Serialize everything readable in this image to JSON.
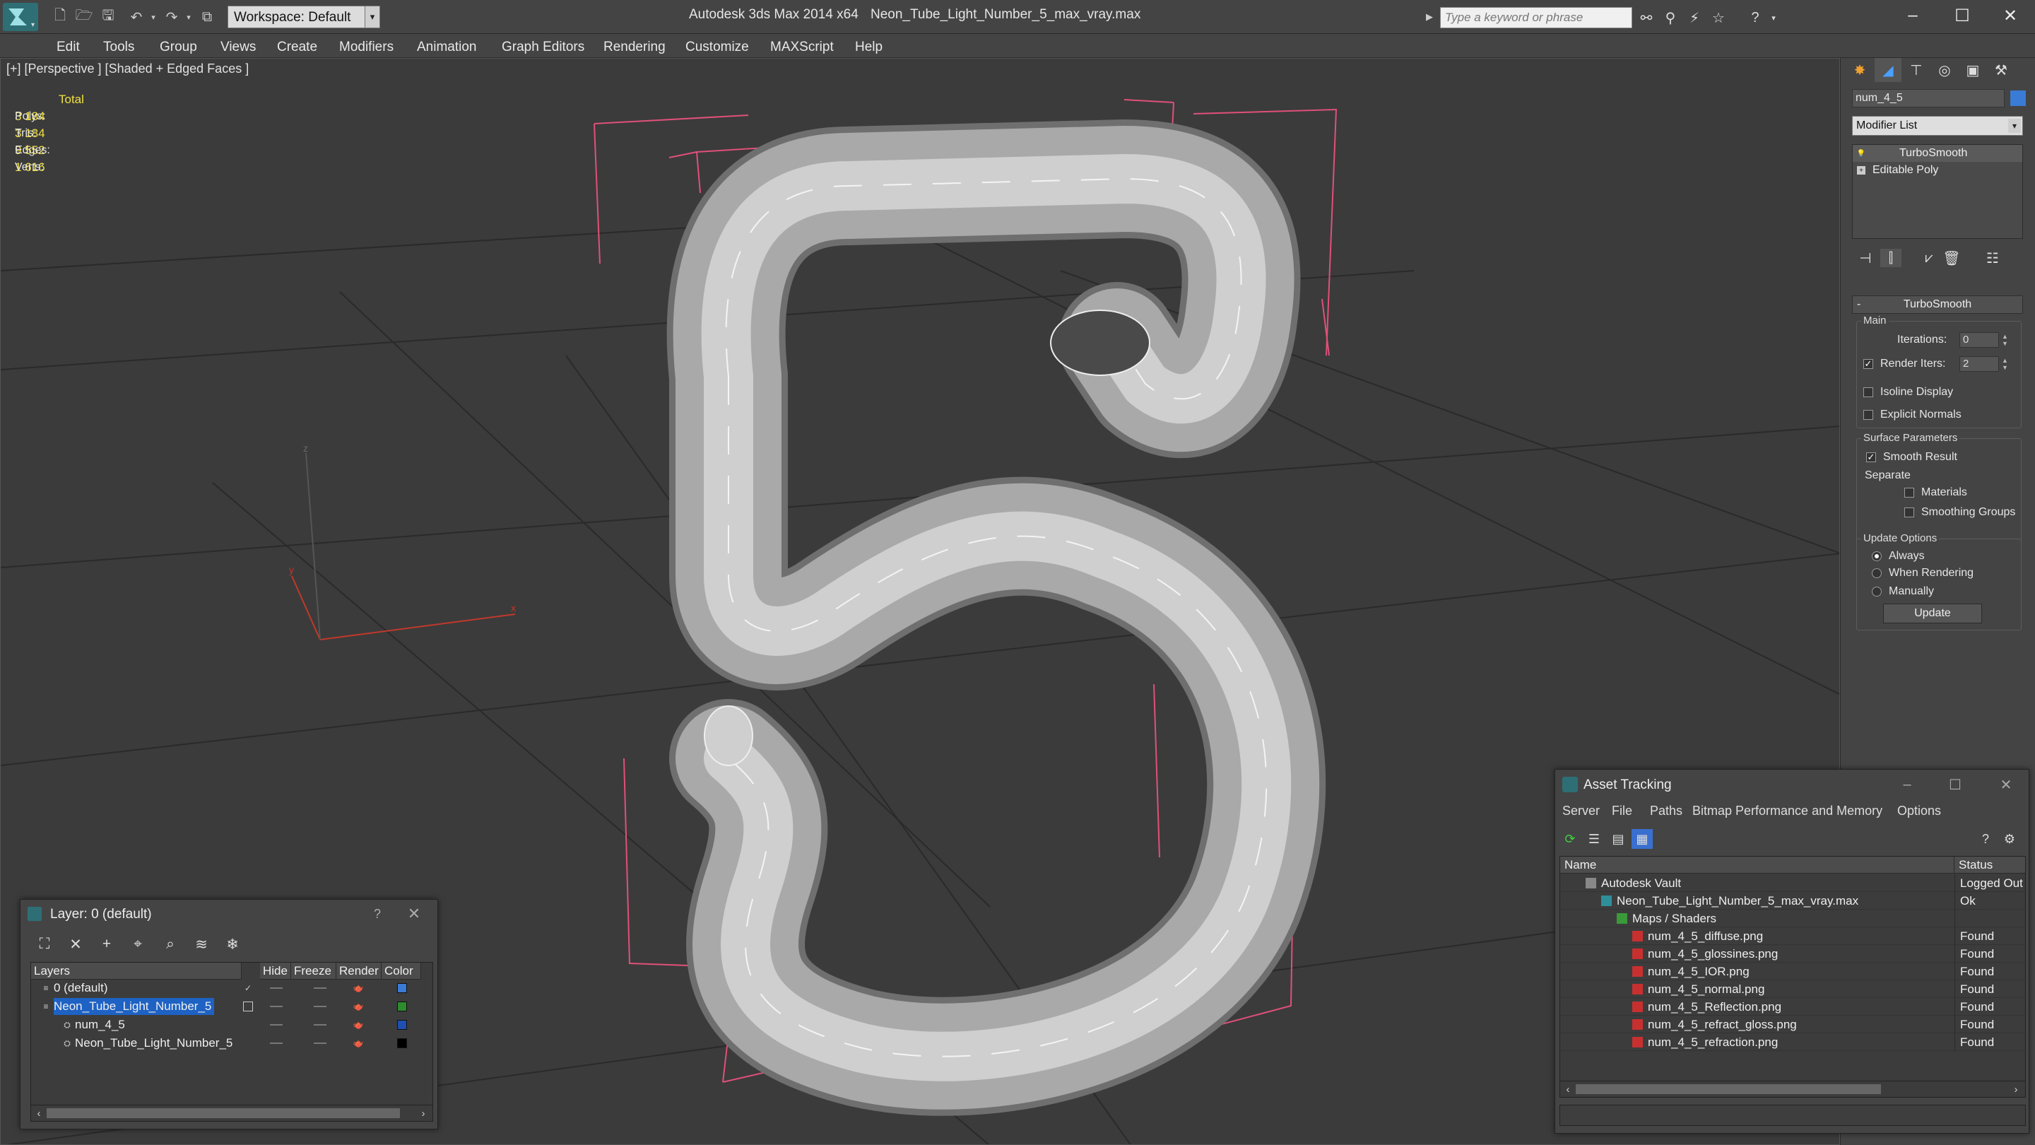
{
  "titlebar": {
    "workspace": "Workspace: Default",
    "app_title": "Autodesk 3ds Max  2014 x64",
    "file_title": "Neon_Tube_Light_Number_5_max_vray.max",
    "search_placeholder": "Type a keyword or phrase",
    "icons": [
      "new-icon",
      "open-icon",
      "save-icon",
      "undo-icon",
      "redo-icon",
      "hold-icon"
    ]
  },
  "menubar": [
    "Edit",
    "Tools",
    "Group",
    "Views",
    "Create",
    "Modifiers",
    "Animation",
    "Graph Editors",
    "Rendering",
    "Customize",
    "MAXScript",
    "Help"
  ],
  "viewport": {
    "label": "[+] [Perspective ] [Shaded + Edged Faces ]",
    "stats": {
      "header": "Total",
      "rows": [
        {
          "label": "Polys:",
          "value": "3 184"
        },
        {
          "label": "Tris:",
          "value": "3 184"
        },
        {
          "label": "Edges:",
          "value": "9 552"
        },
        {
          "label": "Verts:",
          "value": "1 616"
        }
      ]
    },
    "axis_labels": {
      "x": "x",
      "y": "y",
      "z": "z"
    }
  },
  "command_panel": {
    "object_name": "num_4_5",
    "object_color": "#3a7bd5",
    "modifier_list": "Modifier List",
    "stack": [
      {
        "label": "TurboSmooth",
        "selected": true
      },
      {
        "label": "Editable Poly",
        "selected": false
      }
    ],
    "rollout": {
      "title": "TurboSmooth",
      "collapse": "-",
      "main_group": "Main",
      "iterations_label": "Iterations:",
      "iterations_value": "0",
      "render_iters_label": "Render Iters:",
      "render_iters_value": "2",
      "render_iters_checked": true,
      "isoline": "Isoline Display",
      "explicit_normals": "Explicit Normals",
      "surface_group": "Surface Parameters",
      "smooth_result": "Smooth Result",
      "separate": "Separate",
      "materials": "Materials",
      "smoothing_groups": "Smoothing Groups",
      "update_group": "Update Options",
      "always": "Always",
      "when_rendering": "When Rendering",
      "manually": "Manually",
      "update_button": "Update"
    }
  },
  "asset_tracking": {
    "title": "Asset Tracking",
    "menus": [
      "Server",
      "File",
      "Paths",
      "Bitmap Performance and Memory",
      "Options"
    ],
    "columns": {
      "name": "Name",
      "status": "Status"
    },
    "rows": [
      {
        "name": "Autodesk Vault",
        "status": "Logged Out",
        "indent": 1,
        "icon": "vault-icon"
      },
      {
        "name": "Neon_Tube_Light_Number_5_max_vray.max",
        "status": "Ok",
        "indent": 2,
        "icon": "max-file-icon"
      },
      {
        "name": "Maps / Shaders",
        "status": "",
        "indent": 3,
        "icon": "maps-icon"
      },
      {
        "name": "num_4_5_diffuse.png",
        "status": "Found",
        "indent": 4,
        "icon": "png-icon"
      },
      {
        "name": "num_4_5_glossines.png",
        "status": "Found",
        "indent": 4,
        "icon": "png-icon"
      },
      {
        "name": "num_4_5_IOR.png",
        "status": "Found",
        "indent": 4,
        "icon": "png-icon"
      },
      {
        "name": "num_4_5_normal.png",
        "status": "Found",
        "indent": 4,
        "icon": "png-icon"
      },
      {
        "name": "num_4_5_Reflection.png",
        "status": "Found",
        "indent": 4,
        "icon": "png-icon"
      },
      {
        "name": "num_4_5_refract_gloss.png",
        "status": "Found",
        "indent": 4,
        "icon": "png-icon"
      },
      {
        "name": "num_4_5_refraction.png",
        "status": "Found",
        "indent": 4,
        "icon": "png-icon"
      }
    ]
  },
  "layers_dialog": {
    "title": "Layer: 0 (default)",
    "help": "?",
    "columns": {
      "layers": "Layers",
      "hide": "Hide",
      "freeze": "Freeze",
      "render": "Render",
      "color": "Color"
    },
    "rows": [
      {
        "name": "0 (default)",
        "color": "#3a7bd5",
        "selected": false,
        "active": true
      },
      {
        "name": "Neon_Tube_Light_Number_5",
        "color": "#2e8b2e",
        "selected": true,
        "active": false
      },
      {
        "name": "num_4_5",
        "color": "#1f4fb0",
        "selected": false,
        "active": false
      },
      {
        "name": "Neon_Tube_Light_Number_5",
        "color": "#000000",
        "selected": false,
        "active": false
      }
    ]
  }
}
